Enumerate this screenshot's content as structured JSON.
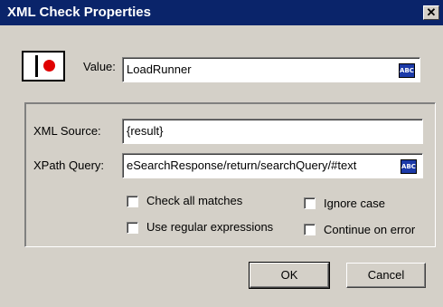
{
  "window": {
    "title": "XML Check Properties",
    "close_glyph": "✕"
  },
  "value_row": {
    "icon": "record-icon",
    "label": "Value:",
    "value": "LoadRunner"
  },
  "source": {
    "xml_source_label": "XML Source:",
    "xml_source_value": "{result}",
    "xpath_label": "XPath Query:",
    "xpath_value": "eSearchResponse/return/searchQuery/#text"
  },
  "abc_label": "ABC",
  "options": {
    "check_all_matches": {
      "label": "Check all matches",
      "checked": false
    },
    "ignore_case": {
      "label": "Ignore case",
      "checked": false
    },
    "use_regular_expressions": {
      "label": "Use regular expressions",
      "checked": false
    },
    "continue_on_error": {
      "label": "Continue on error",
      "checked": false
    }
  },
  "buttons": {
    "ok": "OK",
    "cancel": "Cancel"
  },
  "colors": {
    "titlebar": "#0a246a",
    "face": "#d4d0c8",
    "abc_button": "#1c3aa8",
    "record_dot": "#e00000"
  }
}
